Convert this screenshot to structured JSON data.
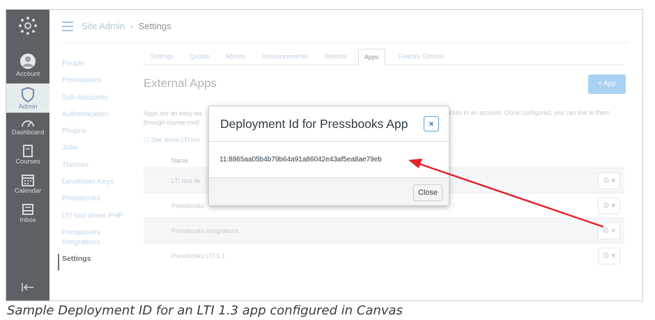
{
  "sidebar": {
    "items": [
      {
        "label": "Account",
        "icon": "account-icon"
      },
      {
        "label": "Admin",
        "icon": "shield-icon"
      },
      {
        "label": "Dashboard",
        "icon": "dashboard-icon"
      },
      {
        "label": "Courses",
        "icon": "book-icon"
      },
      {
        "label": "Calendar",
        "icon": "calendar-icon"
      },
      {
        "label": "Inbox",
        "icon": "inbox-icon"
      }
    ],
    "collapse_icon": "collapse-icon"
  },
  "breadcrumb": {
    "root": "Site Admin",
    "separator": "›",
    "current": "Settings"
  },
  "subnav": {
    "items": [
      "People",
      "Permissions",
      "Sub-Accounts",
      "Authentication",
      "Plugins",
      "Jobs",
      "Themes",
      "Developer Keys",
      "Pressbooks",
      "LTI tool demo PHP",
      "Pressbooks Integrations",
      "Settings"
    ],
    "active": "Settings"
  },
  "tabs": [
    "Settings",
    "Quotas",
    "Admins",
    "Announcements",
    "Reports",
    "Apps",
    "Feature Options"
  ],
  "active_tab": "Apps",
  "external_apps": {
    "title": "External Apps",
    "add_button": "+ App",
    "desc_left": "Apps are an easy wa",
    "desc_left_2": "through course mod",
    "desc_right": "urses in an account. Once configured, you can link to them",
    "see_some": "See some LTI too",
    "name_header": "Name",
    "rows": [
      "LTI tool de",
      "Pressbooks",
      "Pressbooks Integrations",
      "Pressbooks LTI 1.1"
    ]
  },
  "modal": {
    "title": "Deployment Id for Pressbooks App",
    "close_x": "×",
    "deployment_id": "11:8865aa05b4b79b64a91a86042e43af5ea8ae79eb",
    "close_button": "Close"
  },
  "caption": "Sample Deployment ID for an LTI 1.3 app configured in Canvas",
  "colors": {
    "sidebar_bg": "#5d6166",
    "link": "#bfd4e8",
    "arrow": "#e4202a",
    "primary": "#a8d2f2"
  }
}
